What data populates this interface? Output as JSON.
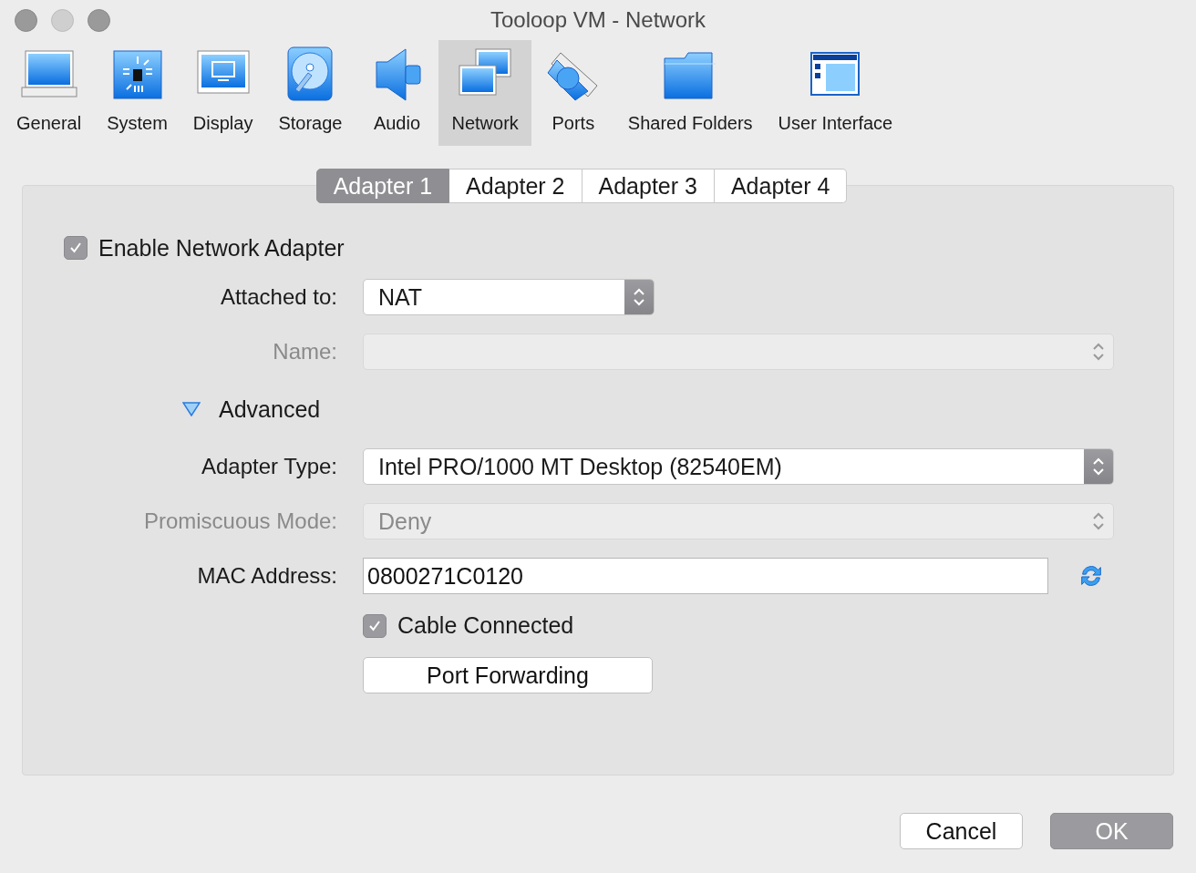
{
  "window": {
    "title": "Tooloop VM - Network"
  },
  "toolbar": [
    {
      "label": "General",
      "kind": "general",
      "selected": false
    },
    {
      "label": "System",
      "kind": "system",
      "selected": false
    },
    {
      "label": "Display",
      "kind": "display",
      "selected": false
    },
    {
      "label": "Storage",
      "kind": "storage",
      "selected": false
    },
    {
      "label": "Audio",
      "kind": "audio",
      "selected": false
    },
    {
      "label": "Network",
      "kind": "network",
      "selected": true
    },
    {
      "label": "Ports",
      "kind": "ports",
      "selected": false
    },
    {
      "label": "Shared Folders",
      "kind": "folders",
      "selected": false
    },
    {
      "label": "User Interface",
      "kind": "ui",
      "selected": false
    }
  ],
  "tabs": [
    {
      "label": "Adapter 1",
      "selected": true
    },
    {
      "label": "Adapter 2",
      "selected": false
    },
    {
      "label": "Adapter 3",
      "selected": false
    },
    {
      "label": "Adapter 4",
      "selected": false
    }
  ],
  "enable_adapter": {
    "label": "Enable Network Adapter",
    "checked": true
  },
  "rows": [
    {
      "kind": "short-select",
      "label": "Attached to:",
      "value": "NAT",
      "disabled": false
    },
    {
      "kind": "select",
      "label": "Name:",
      "disabled": true
    },
    {
      "kind": "disclosure",
      "label": "Advanced",
      "expanded": true
    },
    {
      "kind": "select",
      "label": "Adapter Type:",
      "value": "Intel PRO/1000 MT Desktop (82540EM)",
      "disabled": false
    },
    {
      "kind": "select",
      "label": "Promiscuous Mode:",
      "value": "Deny",
      "disabled": true
    },
    {
      "kind": "text",
      "label": "MAC Address:",
      "value": "0800271C0120"
    },
    {
      "kind": "checkbox",
      "label": "Cable Connected",
      "checked": true
    },
    {
      "kind": "button",
      "label": "Port Forwarding"
    }
  ],
  "buttons": [
    {
      "label": "Cancel",
      "kind": "normal"
    },
    {
      "label": "OK",
      "kind": "default"
    }
  ]
}
